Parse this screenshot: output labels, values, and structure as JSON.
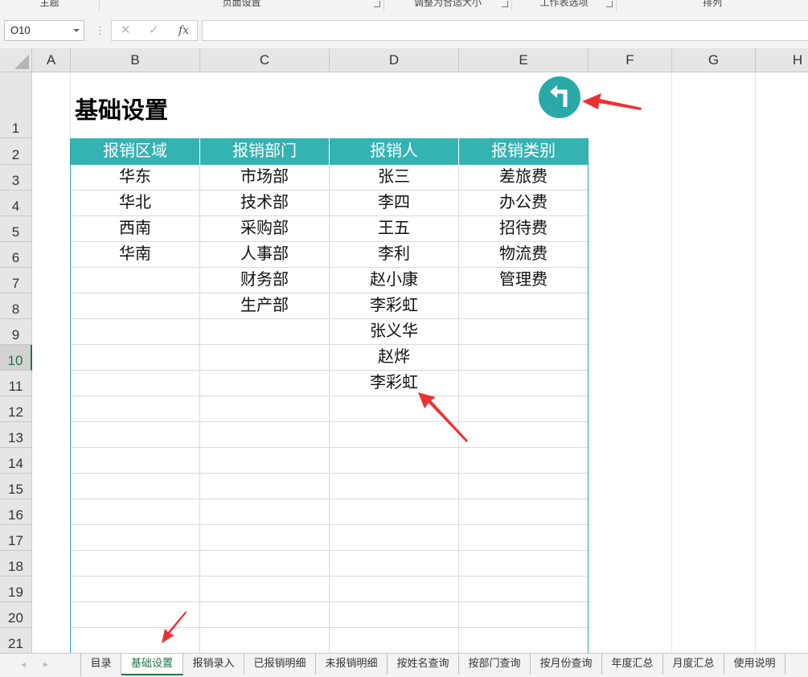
{
  "ribbon": {
    "groups": [
      {
        "label": "主题"
      },
      {
        "label": "页面设置"
      },
      {
        "label": "调整为合适大小"
      },
      {
        "label": "工作表选项"
      },
      {
        "label": "排列"
      }
    ]
  },
  "formula_bar": {
    "name_box": "O10",
    "cancel_icon": "✕",
    "enter_icon": "✓",
    "fx_label": "fx",
    "formula": ""
  },
  "columns": [
    "A",
    "B",
    "C",
    "D",
    "E",
    "F",
    "G",
    "H"
  ],
  "rows": [
    "1",
    "2",
    "3",
    "4",
    "5",
    "6",
    "7",
    "8",
    "9",
    "10",
    "11",
    "12",
    "13",
    "14",
    "15",
    "16",
    "17",
    "18",
    "19",
    "20",
    "21"
  ],
  "selected_row": "10",
  "sheet": {
    "title": "基础设置",
    "table": {
      "headers": [
        "报销区域",
        "报销部门",
        "报销人",
        "报销类别"
      ],
      "rows": [
        [
          "华东",
          "市场部",
          "张三",
          "差旅费"
        ],
        [
          "华北",
          "技术部",
          "李四",
          "办公费"
        ],
        [
          "西南",
          "采购部",
          "王五",
          "招待费"
        ],
        [
          "华南",
          "人事部",
          "李利",
          "物流费"
        ],
        [
          "",
          "财务部",
          "赵小康",
          "管理费"
        ],
        [
          "",
          "生产部",
          "李彩虹",
          ""
        ],
        [
          "",
          "",
          "张义华",
          ""
        ],
        [
          "",
          "",
          "赵烨",
          ""
        ],
        [
          "",
          "",
          "李彩虹",
          ""
        ]
      ],
      "header_color": "#35b2b2"
    },
    "back_button_color": "#2aa9a9"
  },
  "annotation_color": "#f03030",
  "tabs": {
    "items": [
      "目录",
      "基础设置",
      "报销录入",
      "已报销明细",
      "未报销明细",
      "按姓名查询",
      "按部门查询",
      "按月份查询",
      "年度汇总",
      "月度汇总",
      "使用说明"
    ],
    "active": "基础设置"
  }
}
